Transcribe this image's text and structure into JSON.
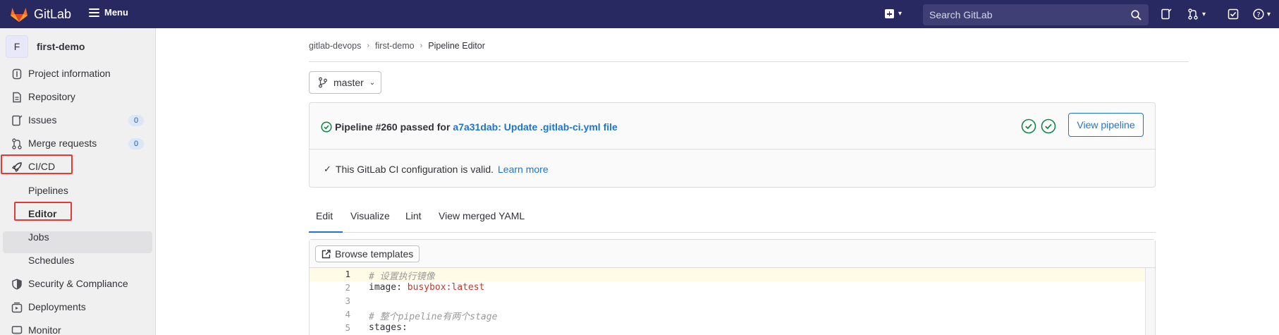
{
  "topbar": {
    "app_name": "GitLab",
    "menu_label": "Menu",
    "search_placeholder": "Search GitLab",
    "bg_color": "#292961"
  },
  "sidebar": {
    "project_initial": "F",
    "project_name": "first-demo",
    "items": [
      {
        "label": "Project information",
        "icon": "info-icon"
      },
      {
        "label": "Repository",
        "icon": "document-icon"
      },
      {
        "label": "Issues",
        "icon": "issues-icon",
        "count": "0"
      },
      {
        "label": "Merge requests",
        "icon": "merge-request-icon",
        "count": "0"
      },
      {
        "label": "CI/CD",
        "icon": "rocket-icon"
      },
      {
        "label": "Security & Compliance",
        "icon": "shield-icon"
      },
      {
        "label": "Deployments",
        "icon": "deployments-icon"
      },
      {
        "label": "Monitor",
        "icon": "monitor-icon"
      }
    ],
    "cicd_subitems": [
      {
        "label": "Pipelines"
      },
      {
        "label": "Editor",
        "active": true
      },
      {
        "label": "Jobs"
      },
      {
        "label": "Schedules"
      }
    ]
  },
  "breadcrumb": [
    "gitlab-devops",
    "first-demo",
    "Pipeline Editor"
  ],
  "branch": "master",
  "pipeline": {
    "status_prefix": "Pipeline #260 passed for",
    "commit_link": "a7a31dab: Update .gitlab-ci.yml file",
    "view_button": "View pipeline"
  },
  "validation": {
    "message": "This GitLab CI configuration is valid.",
    "link": "Learn more"
  },
  "tabs": [
    "Edit",
    "Visualize",
    "Lint",
    "View merged YAML"
  ],
  "editor": {
    "browse_label": "Browse templates",
    "lines": [
      {
        "num": "1",
        "comment": "# 设置执行镜像"
      },
      {
        "num": "2",
        "key": "image:",
        "value": "busybox:latest"
      },
      {
        "num": "3"
      },
      {
        "num": "4",
        "comment": "# 整个pipeline有两个stage"
      },
      {
        "num": "5",
        "key": "stages:"
      }
    ]
  },
  "colors": {
    "accent": "#1f75cb",
    "success": "#108548",
    "annotation": "#e53935"
  }
}
